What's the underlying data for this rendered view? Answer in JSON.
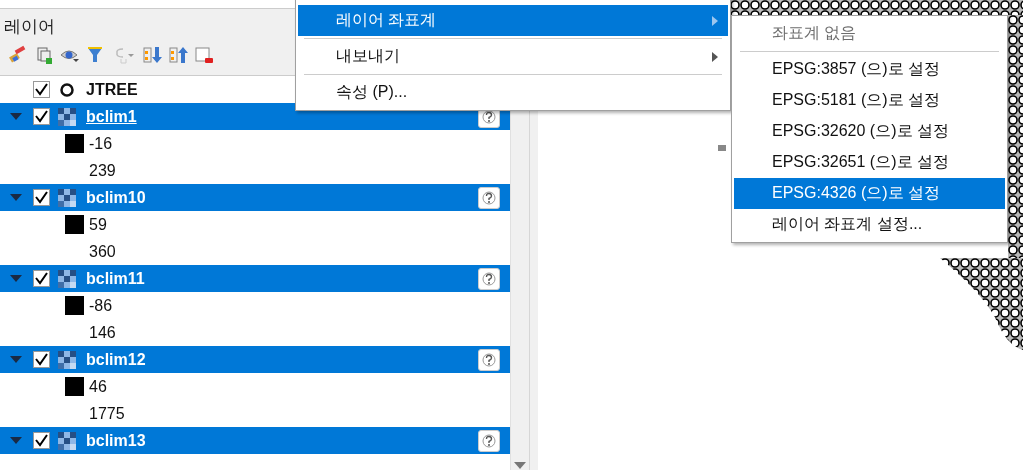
{
  "layers_panel": {
    "title": "레이어",
    "tree": [
      {
        "name": "JTREE",
        "kind": "vector",
        "checked": true,
        "selected": false,
        "current": false
      },
      {
        "name": "bclim1",
        "kind": "raster",
        "checked": true,
        "selected": true,
        "current": true,
        "expanded": true,
        "children": [
          {
            "kind": "swatch",
            "label": "-16"
          },
          {
            "kind": "plain",
            "label": "239"
          }
        ]
      },
      {
        "name": "bclim10",
        "kind": "raster",
        "checked": true,
        "selected": true,
        "current": false,
        "expanded": true,
        "children": [
          {
            "kind": "swatch",
            "label": "59"
          },
          {
            "kind": "plain",
            "label": "360"
          }
        ]
      },
      {
        "name": "bclim11",
        "kind": "raster",
        "checked": true,
        "selected": true,
        "current": false,
        "expanded": true,
        "children": [
          {
            "kind": "swatch",
            "label": "-86"
          },
          {
            "kind": "plain",
            "label": "146"
          }
        ]
      },
      {
        "name": "bclim12",
        "kind": "raster",
        "checked": true,
        "selected": true,
        "current": false,
        "expanded": true,
        "children": [
          {
            "kind": "swatch",
            "label": "46"
          },
          {
            "kind": "plain",
            "label": "1775"
          }
        ]
      },
      {
        "name": "bclim13",
        "kind": "raster",
        "checked": true,
        "selected": true,
        "current": false,
        "expanded": true
      }
    ]
  },
  "context_menu": {
    "items": [
      {
        "kind": "item",
        "label": "레이어 좌표계",
        "submenu": true,
        "selected": true
      },
      {
        "kind": "separator"
      },
      {
        "kind": "item",
        "label": "내보내기",
        "submenu": true,
        "selected": false
      },
      {
        "kind": "separator"
      },
      {
        "kind": "item",
        "label": "속성 (P)...",
        "submenu": false,
        "selected": false
      }
    ]
  },
  "crs_submenu": {
    "items": [
      {
        "kind": "item",
        "label": "좌표계 없음",
        "disabled": true,
        "selected": false
      },
      {
        "kind": "separator"
      },
      {
        "kind": "item",
        "label": "EPSG:3857 (으)로 설정",
        "disabled": false,
        "selected": false
      },
      {
        "kind": "item",
        "label": "EPSG:5181 (으)로 설정",
        "disabled": false,
        "selected": false
      },
      {
        "kind": "item",
        "label": "EPSG:32620 (으)로 설정",
        "disabled": false,
        "selected": false
      },
      {
        "kind": "item",
        "label": "EPSG:32651 (으)로 설정",
        "disabled": false,
        "selected": false
      },
      {
        "kind": "item",
        "label": "EPSG:4326 (으)로 설정",
        "disabled": false,
        "selected": true
      },
      {
        "kind": "item",
        "label": "레이어 좌표계 설정...",
        "disabled": false,
        "selected": false
      }
    ]
  }
}
